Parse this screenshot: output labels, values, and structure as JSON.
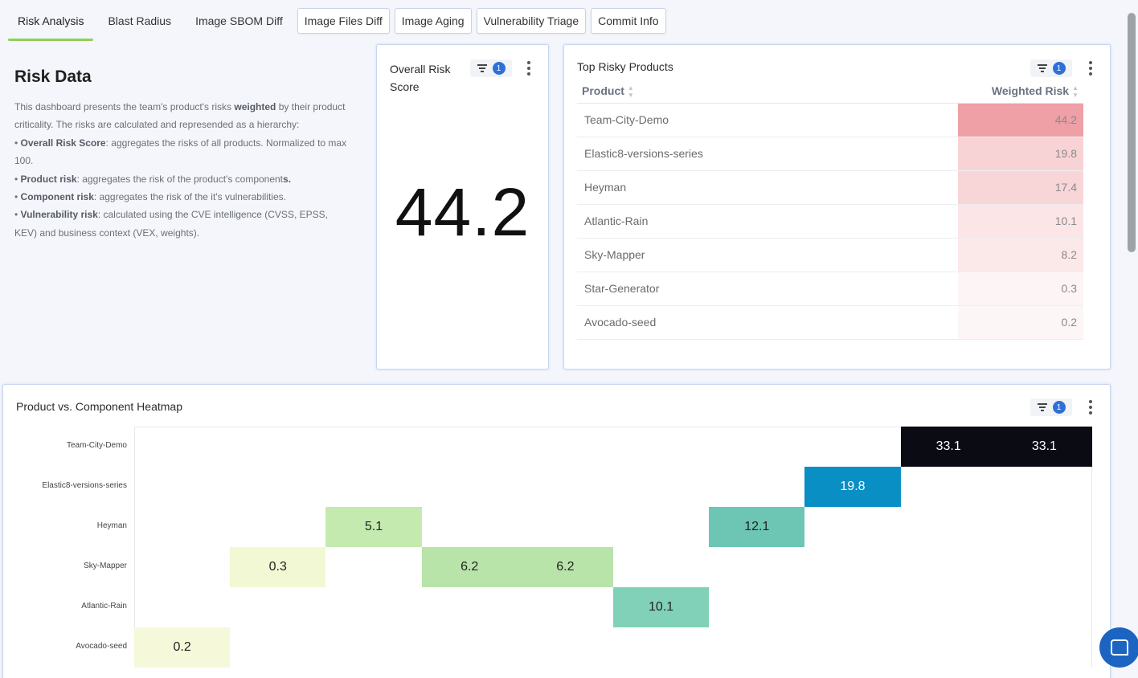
{
  "tabs": [
    {
      "label": "Risk Analysis",
      "active": true
    },
    {
      "label": "Blast Radius"
    },
    {
      "label": "Image SBOM Diff"
    },
    {
      "label": "Image Files Diff"
    },
    {
      "label": "Image Aging"
    },
    {
      "label": "Vulnerability Triage"
    },
    {
      "label": "Commit Info"
    }
  ],
  "description": {
    "title": "Risk Data",
    "intro_pre": "This dashboard presents the team's product's risks ",
    "intro_bold": "weighted",
    "intro_post": " by their product criticality. The risks are calculated and represended as a hierarchy:",
    "items": [
      {
        "bold": "Overall Risk Score",
        "text": ": aggregates the risks of all products. Normalized to max 100."
      },
      {
        "bold": "Product risk",
        "text": ": aggregates the risk of the product's component",
        "tail_bold": "s."
      },
      {
        "bold": "Component risk",
        "text": ": aggregates the risk of the it's vulnerabilities."
      },
      {
        "bold": "Vulnerability risk",
        "text": ": calculated using the CVE intelligence (CVSS, EPSS, KEV) and business context (VEX, weights)."
      }
    ]
  },
  "overall": {
    "title_line1": "Overall Risk",
    "title_line2": "Score",
    "filter_count": "1",
    "value": "44.2"
  },
  "top_risky": {
    "title": "Top Risky Products",
    "filter_count": "1",
    "col_product": "Product",
    "col_risk": "Weighted Risk",
    "rows": [
      {
        "product": "Team-City-Demo",
        "risk": "44.2",
        "color": "#eea0a6"
      },
      {
        "product": "Elastic8-versions-series",
        "risk": "19.8",
        "color": "#f8d3d5"
      },
      {
        "product": "Heyman",
        "risk": "17.4",
        "color": "#f8d6d8"
      },
      {
        "product": "Atlantic-Rain",
        "risk": "10.1",
        "color": "#fbe5e6"
      },
      {
        "product": "Sky-Mapper",
        "risk": "8.2",
        "color": "#fbe8e9"
      },
      {
        "product": "Star-Generator",
        "risk": "0.3",
        "color": "#fdf5f5"
      },
      {
        "product": "Avocado-seed",
        "risk": "0.2",
        "color": "#fdf6f6"
      }
    ]
  },
  "heatmap": {
    "title": "Product vs. Component Heatmap",
    "filter_count": "1",
    "rows": [
      "Team-City-Demo",
      "Elastic8-versions-series",
      "Heyman",
      "Sky-Mapper",
      "Atlantic-Rain",
      "Avocado-seed"
    ],
    "cells": [
      {
        "row": 0,
        "col": 8,
        "value": "33.1",
        "color": "#0b0b14",
        "text": "#ffffff"
      },
      {
        "row": 0,
        "col": 9,
        "value": "33.1",
        "color": "#0b0b14",
        "text": "#ffffff"
      },
      {
        "row": 1,
        "col": 7,
        "value": "19.8",
        "color": "#0a8fc4",
        "text": "#ffffff"
      },
      {
        "row": 2,
        "col": 2,
        "value": "5.1",
        "color": "#c5eab0",
        "text": "#222222"
      },
      {
        "row": 2,
        "col": 6,
        "value": "12.1",
        "color": "#6cc6b3",
        "text": "#222222"
      },
      {
        "row": 3,
        "col": 1,
        "value": "0.3",
        "color": "#f1f8d3",
        "text": "#222222"
      },
      {
        "row": 3,
        "col": 3,
        "value": "6.2",
        "color": "#b8e4a9",
        "text": "#222222"
      },
      {
        "row": 3,
        "col": 4,
        "value": "6.2",
        "color": "#b8e4a9",
        "text": "#222222"
      },
      {
        "row": 4,
        "col": 5,
        "value": "10.1",
        "color": "#80d1b8",
        "text": "#222222"
      },
      {
        "row": 5,
        "col": 0,
        "value": "0.2",
        "color": "#f5f9d9",
        "text": "#222222"
      }
    ]
  },
  "icons": {
    "filter": "filter-icon",
    "more": "more-vertical-icon",
    "chat": "chat-icon"
  }
}
